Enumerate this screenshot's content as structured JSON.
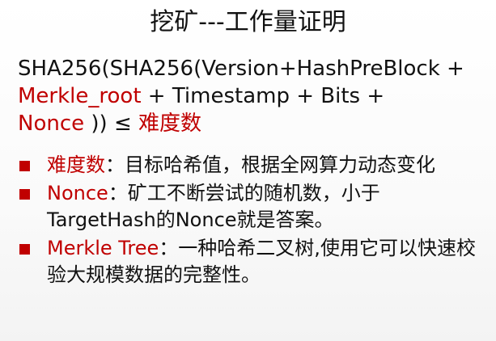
{
  "title": "挖矿---工作量证明",
  "formula": {
    "part1": "SHA256(SHA256(Version+HashPreBlock +",
    "merkle": "Merkle_root",
    "part2": " + Timestamp + Bits +",
    "nonce": "Nonce",
    "part3": " )) ≤ ",
    "difficulty": "难度数"
  },
  "bullets": [
    {
      "term": "难度数",
      "text": "：目标哈希值，根据全网算力动态变化"
    },
    {
      "term": "Nonce",
      "text": "：矿工不断尝试的随机数，小于TargetHash的Nonce就是答案。"
    },
    {
      "term": "Merkle Tree",
      "text": "：一种哈希二叉树,使用它可以快速校验大规模数据的完整性。"
    }
  ],
  "colors": {
    "accent": "#c00000",
    "text": "#111111"
  }
}
